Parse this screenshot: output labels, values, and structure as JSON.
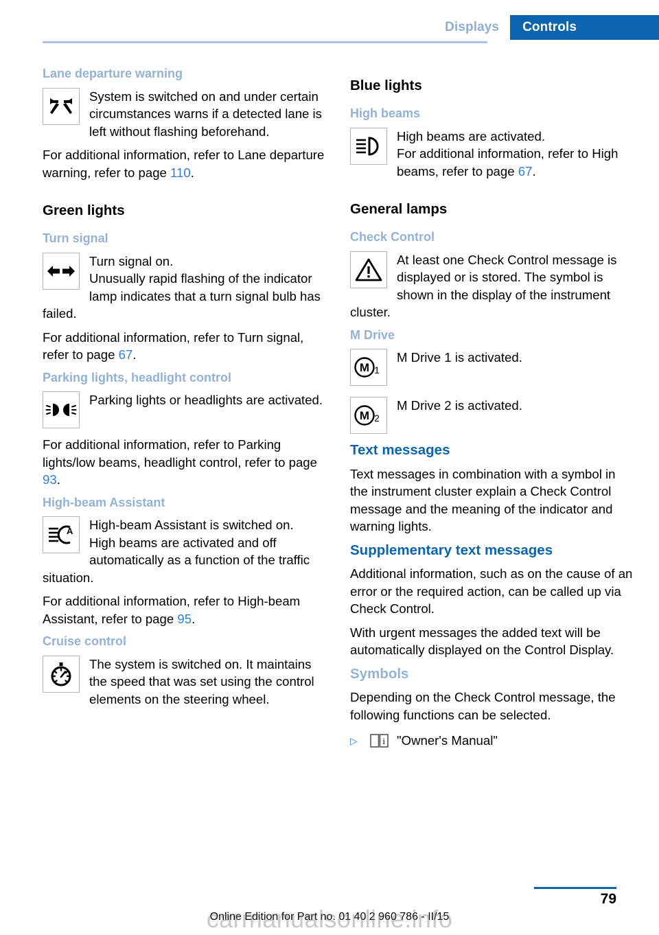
{
  "header": {
    "tab_inactive": "Displays",
    "tab_active": "Controls",
    "accent_color": "#0b64ae",
    "muted_color": "#93b2d6"
  },
  "left_column": {
    "lane_departure": {
      "heading": "Lane departure warning",
      "icon": "lane-departure-warning-icon",
      "line1": "System is switched on and under certain circumstances warns if a detected lane is left without flashing beforehand.",
      "para": "For additional information, refer to Lane departure warning, refer to page ",
      "page": "110",
      "period": "."
    },
    "green_lights": {
      "heading": "Green lights"
    },
    "turn_signal": {
      "heading": "Turn signal",
      "icon": "turn-signal-icon",
      "line1": "Turn signal on.",
      "line2": "Unusually rapid flashing of the indicator lamp indicates that a turn signal bulb has failed.",
      "para": "For additional information, refer to Turn signal, refer to page ",
      "page": "67",
      "period": "."
    },
    "parking_lights": {
      "heading": "Parking lights, headlight control",
      "icon": "parking-lights-icon",
      "line1": "Parking lights or headlights are activated.",
      "para": "For additional information, refer to Parking lights/low beams, headlight control, refer to page ",
      "page": "93",
      "period": "."
    },
    "high_beam_assistant": {
      "heading": "High-beam Assistant",
      "icon": "high-beam-assistant-icon",
      "line1": "High-beam Assistant is switched on.",
      "line2": "High beams are activated and off automatically as a function of the traffic situation.",
      "para": "For additional information, refer to High-beam Assistant, refer to page ",
      "page": "95",
      "period": "."
    },
    "cruise_control": {
      "heading": "Cruise control",
      "icon": "cruise-control-icon",
      "line1": "The system is switched on. It maintains the speed that was set using the control elements on the steering wheel."
    }
  },
  "right_column": {
    "blue_lights": {
      "heading": "Blue lights"
    },
    "high_beams": {
      "heading": "High beams",
      "icon": "high-beams-icon",
      "line1": "High beams are activated.",
      "line2": "For additional information, refer to High beams, refer to page ",
      "page": "67",
      "period": "."
    },
    "general_lamps": {
      "heading": "General lamps"
    },
    "check_control": {
      "heading": "Check Control",
      "icon": "warning-triangle-icon",
      "line1": "At least one Check Control message is displayed or is stored. The symbol is shown in the display of the instrument cluster."
    },
    "m_drive": {
      "heading": "M Drive",
      "entries": [
        {
          "icon": "m-drive-1-icon",
          "label": "M",
          "sub": "1",
          "text": "M Drive 1 is activated."
        },
        {
          "icon": "m-drive-2-icon",
          "label": "M",
          "sub": "2",
          "text": "M Drive 2 is activated."
        }
      ]
    },
    "text_messages": {
      "heading": "Text messages",
      "para": "Text messages in combination with a symbol in the instrument cluster explain a Check Control message and the meaning of the indicator and warning lights."
    },
    "supplementary": {
      "heading": "Supplementary text messages",
      "para1": "Additional information, such as on the cause of an error or the required action, can be called up via Check Control.",
      "para2": "With urgent messages the added text will be automatically displayed on the Control Display."
    },
    "symbols": {
      "heading": "Symbols",
      "para": "Depending on the Check Control message, the following functions can be selected.",
      "bullets": [
        {
          "marker": "▷",
          "icon": "owners-manual-book-icon",
          "label": "\"Owner's Manual\""
        }
      ]
    }
  },
  "footer": {
    "page_number": "79",
    "note": "Online Edition for Part no. 01 40 2 960 786 - II/15",
    "watermark": "carmanualsonline.info"
  }
}
